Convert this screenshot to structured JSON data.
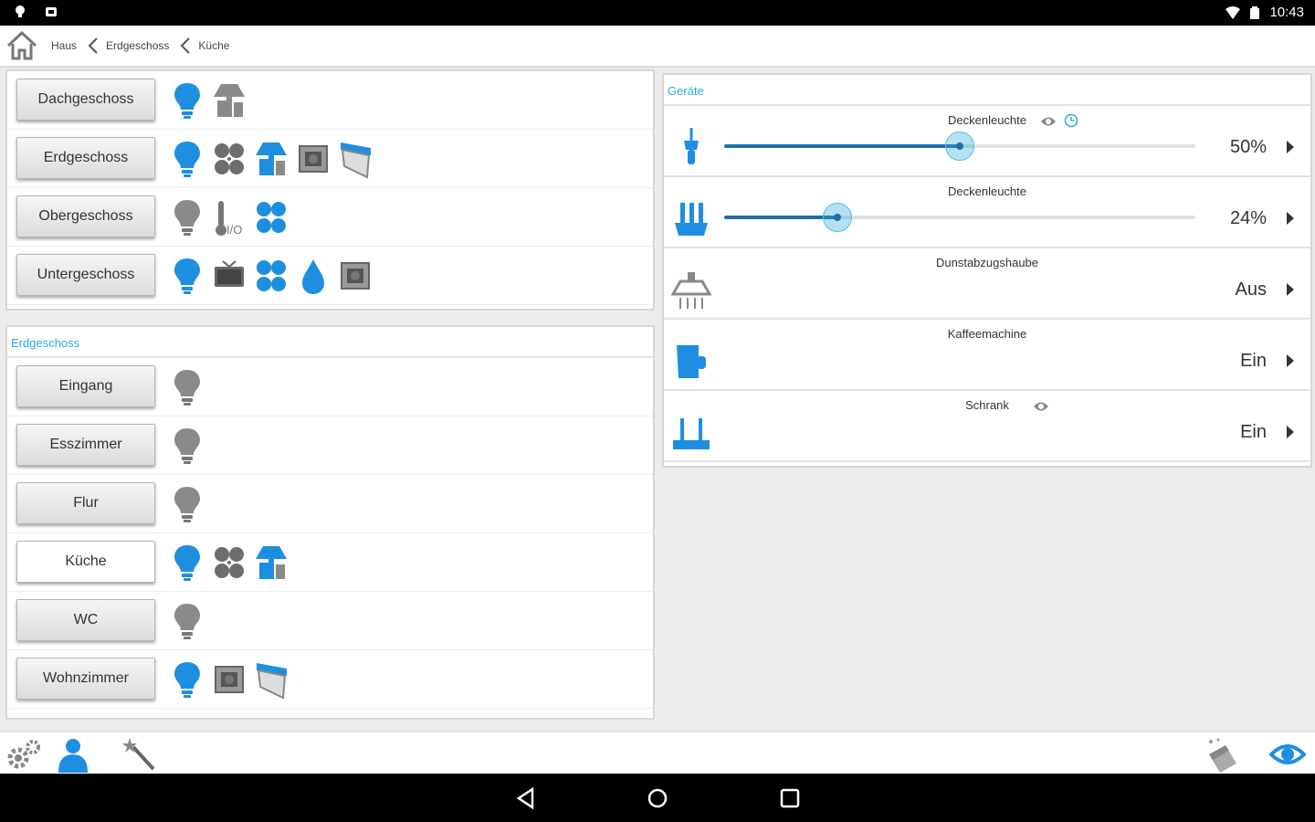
{
  "status": {
    "time": "10:43"
  },
  "breadcrumb": {
    "items": [
      "Haus",
      "Erdgeschoss",
      "Küche"
    ]
  },
  "floors": {
    "items": [
      {
        "label": "Dachgeschoss",
        "icons": [
          "light-on-icon",
          "hood-icon"
        ]
      },
      {
        "label": "Erdgeschoss",
        "icons": [
          "light-on-icon",
          "fan-icon",
          "hood-icon",
          "socket-icon",
          "blind-icon"
        ]
      },
      {
        "label": "Obergeschoss",
        "icons": [
          "light-off-icon",
          "thermometer-icon",
          "fan-icon"
        ],
        "thermo_label": "I/O"
      },
      {
        "label": "Untergeschoss",
        "icons": [
          "light-on-icon",
          "tv-icon",
          "fan-icon",
          "water-drop-icon",
          "socket-icon"
        ]
      }
    ]
  },
  "rooms": {
    "header": "Erdgeschoss",
    "items": [
      {
        "label": "Eingang",
        "icons": [
          "light-off-icon"
        ]
      },
      {
        "label": "Esszimmer",
        "icons": [
          "light-off-icon"
        ]
      },
      {
        "label": "Flur",
        "icons": [
          "light-off-icon"
        ]
      },
      {
        "label": "Küche",
        "icons": [
          "light-on-icon",
          "fan-icon",
          "hood-icon"
        ],
        "active": true
      },
      {
        "label": "WC",
        "icons": [
          "light-off-icon"
        ]
      },
      {
        "label": "Wohnzimmer",
        "icons": [
          "light-on-icon",
          "socket-icon",
          "blind-icon"
        ]
      }
    ]
  },
  "devices": {
    "header": "Geräte",
    "items": [
      {
        "title": "Deckenleuchte",
        "value": "50%",
        "level": 0.5,
        "icon": "pendant-lamp-icon",
        "has_slider": true,
        "eye": true,
        "clock": true
      },
      {
        "title": "Deckenleuchte",
        "value": "24%",
        "level": 0.24,
        "icon": "chandelier-icon",
        "has_slider": true
      },
      {
        "title": "Dunstabzugshaube",
        "value": "Aus",
        "icon": "range-hood-icon"
      },
      {
        "title": "Kaffeemachine",
        "value": "Ein",
        "icon": "coffee-machine-icon"
      },
      {
        "title": "Schrank",
        "value": "Ein",
        "icon": "cabinet-icon",
        "eye": true
      }
    ]
  },
  "colors": {
    "accent": "#2aa9e0",
    "icon_blue": "#1e8fe0",
    "icon_gray": "#777777"
  }
}
